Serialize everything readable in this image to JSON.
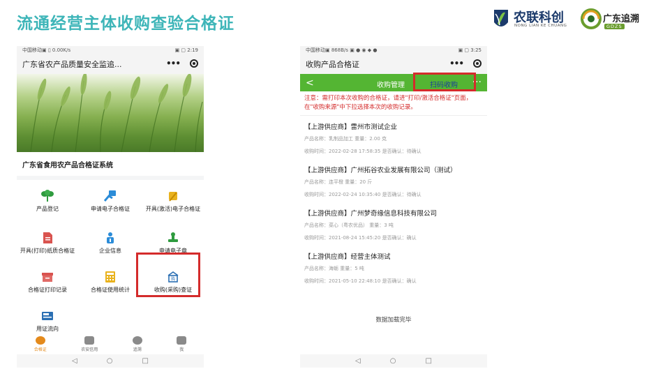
{
  "slide": {
    "title": "流通经营主体收购查验合格证",
    "logo1_name": "农联科创",
    "logo1_pinyin": "NONG LIAN KE CHUANG",
    "logo2_name": "广东追溯",
    "logo2_tag": "GDZS"
  },
  "phone1": {
    "status_left": "中国移动▣ ▯ 0.00K/s",
    "status_right": "▣ ▢ 2:19",
    "title": "广东省农产品质量安全监追...",
    "system_title": "广东省食用农产品合格证系统",
    "grid": [
      {
        "label": "产品登记",
        "icon": "sprout-icon",
        "color": "#2f9b3f"
      },
      {
        "label": "申请电子合格证",
        "icon": "hand-card-icon",
        "color": "#2b8cd8"
      },
      {
        "label": "开具(激活)电子合格证",
        "icon": "hand-pen-icon",
        "color": "#e9b21d"
      },
      {
        "label": "开具(打印)纸质合格证",
        "icon": "document-icon",
        "color": "#d9534f"
      },
      {
        "label": "企业信息",
        "icon": "info-icon",
        "color": "#2b8cd8"
      },
      {
        "label": "申请电子章",
        "icon": "stamp-icon",
        "color": "#2f9b3f"
      },
      {
        "label": "合格证打印记录",
        "icon": "printer-box-icon",
        "color": "#d9534f"
      },
      {
        "label": "合格证使用统计",
        "icon": "calculator-icon",
        "color": "#e9b21d"
      },
      {
        "label": "收购(采购)查证",
        "icon": "shop-check-icon",
        "color": "#2b6fb3"
      },
      {
        "label": "用证流向",
        "icon": "sale-tag-icon",
        "color": "#2b6fb3"
      }
    ],
    "tabs": [
      {
        "label": "合格证",
        "active": true
      },
      {
        "label": "农安信用",
        "active": false
      },
      {
        "label": "追溯",
        "active": false
      },
      {
        "label": "我",
        "active": false
      }
    ],
    "nav": [
      "◁",
      "○",
      "□"
    ]
  },
  "phone2": {
    "status_left": "中国移动▣ 868B/s ▣ ● ◉ ◆ ●",
    "status_right": "▣ ▢ 3:25",
    "title": "收购产品合格证",
    "bar_back": "<",
    "bar_mid": "收购管理",
    "bar_scan": "扫码收购",
    "bar_more": "···",
    "notice": "注意：需打印本次收购的合格证，请进\"打印/激活合格证\"页面，在\"收购来源\"中下拉选择本次的收购记录。",
    "records": [
      {
        "supplier": "【上游供应商】雷州市测试企业",
        "product": "产品名称：乳制品加工   重量：2.00 克",
        "time": "收购时间：2022-02-28 17:58:35   是否确认：待确认"
      },
      {
        "supplier": "【上游供应商】广州拓谷农业发展有限公司（测试）",
        "product": "产品名称：连平橙   重量：20 斤",
        "time": "收购时间：2022-02-24 10:35:40   是否确认：待确认"
      },
      {
        "supplier": "【上游供应商】广州梦奇缘信息科技有限公司",
        "product": "产品名称：菜心（粤农优品）   重量：3 吨",
        "time": "收购时间：2021-08-24 15:45:20   是否确认：确认"
      },
      {
        "supplier": "【上游供应商】经营主体测试",
        "product": "产品名称：海蛎   重量：5 吨",
        "time": "收购时间：2021-05-10 22:48:10   是否确认：确认"
      }
    ],
    "done": "数据加载完毕",
    "nav": [
      "◁",
      "○",
      "□"
    ]
  }
}
